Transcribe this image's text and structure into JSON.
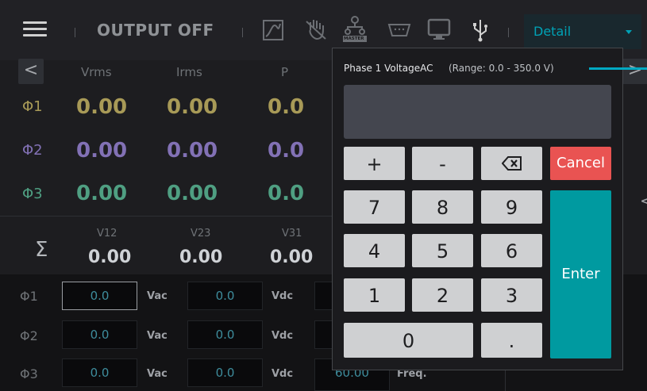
{
  "header": {
    "title": "OUTPUT OFF",
    "mode_select": "Detail",
    "icons": [
      "menu-icon",
      "waveform-icon",
      "hand-icon",
      "master-icon",
      "serial-port-icon",
      "monitor-icon",
      "usb-icon"
    ],
    "master_label": "MASTER"
  },
  "measurement": {
    "columns": [
      "Vrms",
      "Irms",
      "P"
    ],
    "rows": [
      {
        "phase": "Φ1",
        "values": [
          "0.00",
          "0.00",
          "0.0"
        ]
      },
      {
        "phase": "Φ2",
        "values": [
          "0.00",
          "0.00",
          "0.0"
        ]
      },
      {
        "phase": "Φ3",
        "values": [
          "0.00",
          "0.00",
          "0.0"
        ]
      }
    ],
    "sum_symbol": "Σ",
    "line_columns": [
      "V12",
      "V23",
      "V31"
    ],
    "line_values": [
      "0.00",
      "0.00",
      "0.00"
    ],
    "nav_left": "<",
    "nav_right": ">",
    "side_arrow": "<"
  },
  "settings": {
    "rows": [
      {
        "phase": "Φ1",
        "vac": "0.0",
        "vac_unit": "Vac",
        "vdc": "0.0",
        "vdc_unit": "Vdc"
      },
      {
        "phase": "Φ2",
        "vac": "0.0",
        "vac_unit": "Vac",
        "vdc": "0.0",
        "vdc_unit": "Vdc"
      },
      {
        "phase": "Φ3",
        "vac": "0.0",
        "vac_unit": "Vac",
        "vdc": "0.0",
        "vdc_unit": "Vdc"
      }
    ],
    "freq_value": "60.00",
    "freq_unit": "Freq."
  },
  "keypad": {
    "title": "Phase 1 VoltageAC",
    "range": "(Range: 0.0 - 350.0 V)",
    "display": "",
    "keys": {
      "plus": "+",
      "minus": "-",
      "backspace": "⌫",
      "seven": "7",
      "eight": "8",
      "nine": "9",
      "four": "4",
      "five": "5",
      "six": "6",
      "one": "1",
      "two": "2",
      "three": "3",
      "zero": "0",
      "dot": "."
    },
    "cancel": "Cancel",
    "enter": "Enter"
  },
  "colors": {
    "accent": "#00a2b6",
    "phase1": "#a89a57",
    "phase2": "#8271b5",
    "phase3": "#4f9f82",
    "cancel": "#e95352",
    "enter": "#009aa0"
  }
}
